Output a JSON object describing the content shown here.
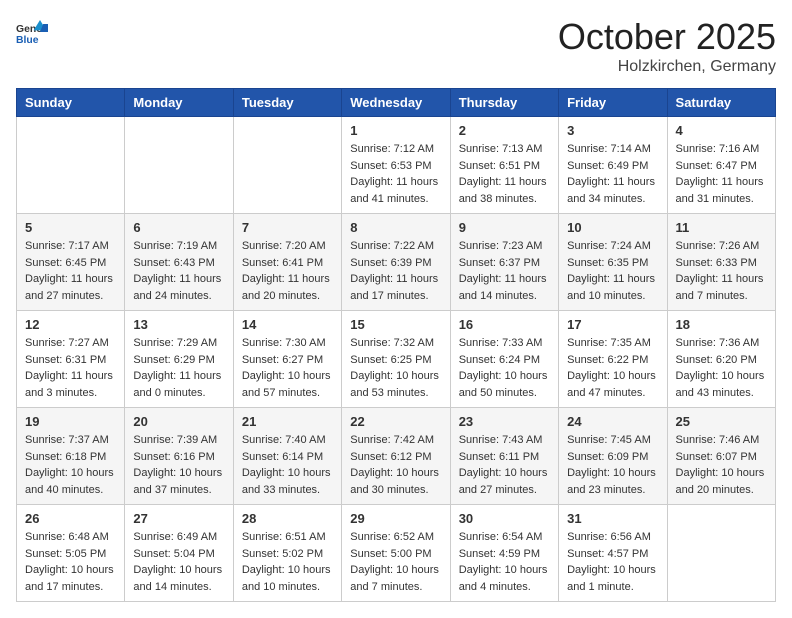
{
  "header": {
    "logo_line1": "General",
    "logo_line2": "Blue",
    "month": "October 2025",
    "location": "Holzkirchen, Germany"
  },
  "weekdays": [
    "Sunday",
    "Monday",
    "Tuesday",
    "Wednesday",
    "Thursday",
    "Friday",
    "Saturday"
  ],
  "weeks": [
    [
      {
        "day": "",
        "info": ""
      },
      {
        "day": "",
        "info": ""
      },
      {
        "day": "",
        "info": ""
      },
      {
        "day": "1",
        "info": "Sunrise: 7:12 AM\nSunset: 6:53 PM\nDaylight: 11 hours and 41 minutes."
      },
      {
        "day": "2",
        "info": "Sunrise: 7:13 AM\nSunset: 6:51 PM\nDaylight: 11 hours and 38 minutes."
      },
      {
        "day": "3",
        "info": "Sunrise: 7:14 AM\nSunset: 6:49 PM\nDaylight: 11 hours and 34 minutes."
      },
      {
        "day": "4",
        "info": "Sunrise: 7:16 AM\nSunset: 6:47 PM\nDaylight: 11 hours and 31 minutes."
      }
    ],
    [
      {
        "day": "5",
        "info": "Sunrise: 7:17 AM\nSunset: 6:45 PM\nDaylight: 11 hours and 27 minutes."
      },
      {
        "day": "6",
        "info": "Sunrise: 7:19 AM\nSunset: 6:43 PM\nDaylight: 11 hours and 24 minutes."
      },
      {
        "day": "7",
        "info": "Sunrise: 7:20 AM\nSunset: 6:41 PM\nDaylight: 11 hours and 20 minutes."
      },
      {
        "day": "8",
        "info": "Sunrise: 7:22 AM\nSunset: 6:39 PM\nDaylight: 11 hours and 17 minutes."
      },
      {
        "day": "9",
        "info": "Sunrise: 7:23 AM\nSunset: 6:37 PM\nDaylight: 11 hours and 14 minutes."
      },
      {
        "day": "10",
        "info": "Sunrise: 7:24 AM\nSunset: 6:35 PM\nDaylight: 11 hours and 10 minutes."
      },
      {
        "day": "11",
        "info": "Sunrise: 7:26 AM\nSunset: 6:33 PM\nDaylight: 11 hours and 7 minutes."
      }
    ],
    [
      {
        "day": "12",
        "info": "Sunrise: 7:27 AM\nSunset: 6:31 PM\nDaylight: 11 hours and 3 minutes."
      },
      {
        "day": "13",
        "info": "Sunrise: 7:29 AM\nSunset: 6:29 PM\nDaylight: 11 hours and 0 minutes."
      },
      {
        "day": "14",
        "info": "Sunrise: 7:30 AM\nSunset: 6:27 PM\nDaylight: 10 hours and 57 minutes."
      },
      {
        "day": "15",
        "info": "Sunrise: 7:32 AM\nSunset: 6:25 PM\nDaylight: 10 hours and 53 minutes."
      },
      {
        "day": "16",
        "info": "Sunrise: 7:33 AM\nSunset: 6:24 PM\nDaylight: 10 hours and 50 minutes."
      },
      {
        "day": "17",
        "info": "Sunrise: 7:35 AM\nSunset: 6:22 PM\nDaylight: 10 hours and 47 minutes."
      },
      {
        "day": "18",
        "info": "Sunrise: 7:36 AM\nSunset: 6:20 PM\nDaylight: 10 hours and 43 minutes."
      }
    ],
    [
      {
        "day": "19",
        "info": "Sunrise: 7:37 AM\nSunset: 6:18 PM\nDaylight: 10 hours and 40 minutes."
      },
      {
        "day": "20",
        "info": "Sunrise: 7:39 AM\nSunset: 6:16 PM\nDaylight: 10 hours and 37 minutes."
      },
      {
        "day": "21",
        "info": "Sunrise: 7:40 AM\nSunset: 6:14 PM\nDaylight: 10 hours and 33 minutes."
      },
      {
        "day": "22",
        "info": "Sunrise: 7:42 AM\nSunset: 6:12 PM\nDaylight: 10 hours and 30 minutes."
      },
      {
        "day": "23",
        "info": "Sunrise: 7:43 AM\nSunset: 6:11 PM\nDaylight: 10 hours and 27 minutes."
      },
      {
        "day": "24",
        "info": "Sunrise: 7:45 AM\nSunset: 6:09 PM\nDaylight: 10 hours and 23 minutes."
      },
      {
        "day": "25",
        "info": "Sunrise: 7:46 AM\nSunset: 6:07 PM\nDaylight: 10 hours and 20 minutes."
      }
    ],
    [
      {
        "day": "26",
        "info": "Sunrise: 6:48 AM\nSunset: 5:05 PM\nDaylight: 10 hours and 17 minutes."
      },
      {
        "day": "27",
        "info": "Sunrise: 6:49 AM\nSunset: 5:04 PM\nDaylight: 10 hours and 14 minutes."
      },
      {
        "day": "28",
        "info": "Sunrise: 6:51 AM\nSunset: 5:02 PM\nDaylight: 10 hours and 10 minutes."
      },
      {
        "day": "29",
        "info": "Sunrise: 6:52 AM\nSunset: 5:00 PM\nDaylight: 10 hours and 7 minutes."
      },
      {
        "day": "30",
        "info": "Sunrise: 6:54 AM\nSunset: 4:59 PM\nDaylight: 10 hours and 4 minutes."
      },
      {
        "day": "31",
        "info": "Sunrise: 6:56 AM\nSunset: 4:57 PM\nDaylight: 10 hours and 1 minute."
      },
      {
        "day": "",
        "info": ""
      }
    ]
  ]
}
